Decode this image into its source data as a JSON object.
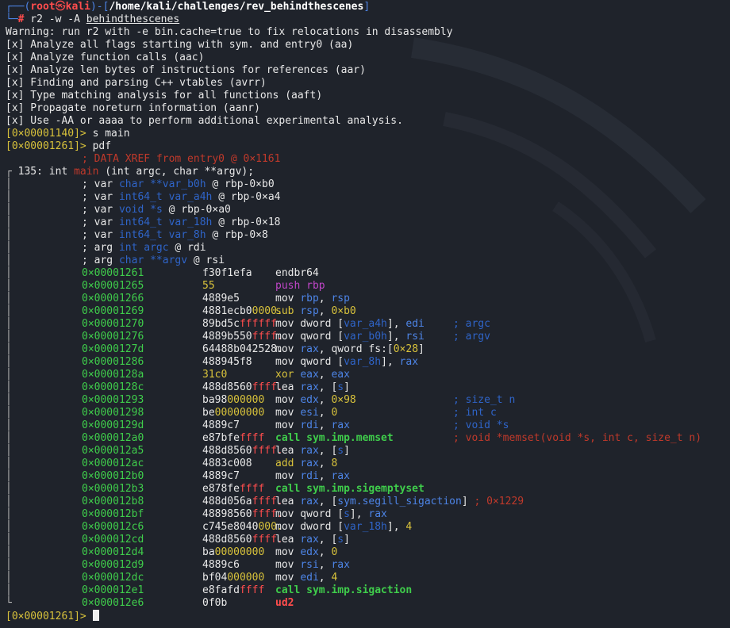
{
  "header": {
    "corner_top": "┌──(",
    "user": "root",
    "at": "㉿",
    "host": "kali",
    "sep": ")-[",
    "path": "/home/kali/challenges/rev_behindthescenes",
    "close": "]",
    "corner_bottom": "└─",
    "hash": "#",
    "cmd": " r2 -w -A ",
    "cmd_arg": "behindthescenes"
  },
  "output": [
    "Warning: run r2 with -e bin.cache=true to fix relocations in disassembly",
    "[x] Analyze all flags starting with sym. and entry0 (aa)",
    "[x] Analyze function calls (aac)",
    "[x] Analyze len bytes of instructions for references (aar)",
    "[x] Finding and parsing C++ vtables (avrr)",
    "[x] Type matching analysis for all functions (aaft)",
    "[x] Propagate noreturn information (aanr)",
    "[x] Use -AA or aaaa to perform additional experimental analysis."
  ],
  "prompts": {
    "p1": "[0×00001140]>",
    "p1_cmd": " s main",
    "p2": "[0×00001261]>",
    "p2_cmd": " pdf",
    "final": "[0×00001261]>"
  },
  "func": {
    "xref": "; DATA XREF from entry0 @ 0×1161",
    "bracket": "┌",
    "size": " 135: int ",
    "name": "main",
    "sig": " (int argc, char **argv);",
    "vars": [
      {
        "kw": "; var ",
        "type": "char **",
        "name": "var_b0h",
        "loc": " @ rbp-0×b0"
      },
      {
        "kw": "; var ",
        "type": "int64_t ",
        "name": "var_a4h",
        "loc": " @ rbp-0×a4"
      },
      {
        "kw": "; var ",
        "type": "void *",
        "name": "s",
        "loc": " @ rbp-0×a0"
      },
      {
        "kw": "; var ",
        "type": "int64_t ",
        "name": "var_18h",
        "loc": " @ rbp-0×18"
      },
      {
        "kw": "; var ",
        "type": "int64_t ",
        "name": "var_8h",
        "loc": " @ rbp-0×8"
      },
      {
        "kw": "; arg ",
        "type": "int ",
        "name": "argc",
        "loc": " @ rdi"
      },
      {
        "kw": "; arg ",
        "type": "char **",
        "name": "argv",
        "loc": " @ rsi"
      }
    ]
  },
  "disasm": [
    {
      "addr": "0×00001261",
      "b1": "f30f1efa",
      "b2": "",
      "ins": [
        [
          "w",
          "endbr64"
        ]
      ],
      "cm": ""
    },
    {
      "addr": "0×00001265",
      "b1": "",
      "b2": "55",
      "b2c": "y",
      "ins": [
        [
          "m",
          "push rbp"
        ]
      ],
      "cm": ""
    },
    {
      "addr": "0×00001266",
      "b1": "4889e5",
      "b2": "",
      "ins": [
        [
          "w",
          "mov "
        ],
        [
          "b",
          "rbp"
        ],
        [
          "w",
          ", "
        ],
        [
          "b",
          "rsp"
        ]
      ],
      "cm": ""
    },
    {
      "addr": "0×00001269",
      "b1": "4881ecb0",
      "b2": "0000.",
      "b2c": "y",
      "ins": [
        [
          "y",
          "sub "
        ],
        [
          "b",
          "rsp"
        ],
        [
          "w",
          ", "
        ],
        [
          "y",
          "0×b0"
        ]
      ],
      "cm": ""
    },
    {
      "addr": "0×00001270",
      "b1": "89bd5c",
      "b2": "ffffff",
      "b2c": "r",
      "ins": [
        [
          "w",
          "mov dword ["
        ],
        [
          "d",
          "var_a4h"
        ],
        [
          "w",
          "], "
        ],
        [
          "b",
          "edi"
        ]
      ],
      "cm": "; argc"
    },
    {
      "addr": "0×00001276",
      "b1": "4889b550",
      "b2": "ffff.",
      "b2c": "r",
      "ins": [
        [
          "w",
          "mov qword ["
        ],
        [
          "d",
          "var_b0h"
        ],
        [
          "w",
          "], "
        ],
        [
          "b",
          "rsi"
        ]
      ],
      "cm": "; argv"
    },
    {
      "addr": "0×0000127d",
      "b1": "64488b042528.",
      "b2": "",
      "ins": [
        [
          "w",
          "mov "
        ],
        [
          "b",
          "rax"
        ],
        [
          "w",
          ", qword fs:["
        ],
        [
          "y",
          "0×28"
        ],
        [
          "w",
          "]"
        ]
      ],
      "cm": ""
    },
    {
      "addr": "0×00001286",
      "b1": "488945f8",
      "b2": "",
      "ins": [
        [
          "w",
          "mov qword ["
        ],
        [
          "d",
          "var_8h"
        ],
        [
          "w",
          "], "
        ],
        [
          "b",
          "rax"
        ]
      ],
      "cm": ""
    },
    {
      "addr": "0×0000128a",
      "b1": "",
      "b2": "31c0",
      "b2c": "y",
      "ins": [
        [
          "y",
          "xor "
        ],
        [
          "b",
          "eax"
        ],
        [
          "w",
          ", "
        ],
        [
          "b",
          "eax"
        ]
      ],
      "cm": ""
    },
    {
      "addr": "0×0000128c",
      "b1": "488d8560",
      "b2": "ffff.",
      "b2c": "r",
      "ins": [
        [
          "w",
          "lea "
        ],
        [
          "b",
          "rax"
        ],
        [
          "w",
          ", ["
        ],
        [
          "d",
          "s"
        ],
        [
          "w",
          "]"
        ]
      ],
      "cm": ""
    },
    {
      "addr": "0×00001293",
      "b1": "ba98",
      "b2": "000000",
      "b2c": "y",
      "ins": [
        [
          "w",
          "mov "
        ],
        [
          "b",
          "edx"
        ],
        [
          "w",
          ", "
        ],
        [
          "y",
          "0×98"
        ]
      ],
      "cm": "; size_t n"
    },
    {
      "addr": "0×00001298",
      "b1": "be",
      "b2": "00000000",
      "b2c": "y",
      "ins": [
        [
          "w",
          "mov "
        ],
        [
          "b",
          "esi"
        ],
        [
          "w",
          ", "
        ],
        [
          "y",
          "0"
        ]
      ],
      "cm": "; int c"
    },
    {
      "addr": "0×0000129d",
      "b1": "4889c7",
      "b2": "",
      "ins": [
        [
          "w",
          "mov "
        ],
        [
          "b",
          "rdi"
        ],
        [
          "w",
          ", "
        ],
        [
          "b",
          "rax"
        ]
      ],
      "cm": "; void *s"
    },
    {
      "addr": "0×000012a0",
      "b1": "e87bfe",
      "b2": "ffff",
      "b2c": "r",
      "ins": [
        [
          "g",
          "call sym.imp.memset"
        ]
      ],
      "cm": "; void *memset(void *s, int c, size_t n)",
      "cmc": "r"
    },
    {
      "addr": "0×000012a5",
      "b1": "488d8560",
      "b2": "ffff.",
      "b2c": "r",
      "ins": [
        [
          "w",
          "lea "
        ],
        [
          "b",
          "rax"
        ],
        [
          "w",
          ", ["
        ],
        [
          "d",
          "s"
        ],
        [
          "w",
          "]"
        ]
      ],
      "cm": ""
    },
    {
      "addr": "0×000012ac",
      "b1": "4883c008",
      "b2": "",
      "ins": [
        [
          "y",
          "add "
        ],
        [
          "b",
          "rax"
        ],
        [
          "w",
          ", "
        ],
        [
          "y",
          "8"
        ]
      ],
      "cm": ""
    },
    {
      "addr": "0×000012b0",
      "b1": "4889c7",
      "b2": "",
      "ins": [
        [
          "w",
          "mov "
        ],
        [
          "b",
          "rdi"
        ],
        [
          "w",
          ", "
        ],
        [
          "b",
          "rax"
        ]
      ],
      "cm": ""
    },
    {
      "addr": "0×000012b3",
      "b1": "e878fe",
      "b2": "ffff",
      "b2c": "r",
      "ins": [
        [
          "g",
          "call sym.imp.sigemptyset"
        ]
      ],
      "cm": ""
    },
    {
      "addr": "0×000012b8",
      "b1": "488d056a",
      "b2": "ffff.",
      "b2c": "r",
      "ins": [
        [
          "w",
          "lea "
        ],
        [
          "b",
          "rax"
        ],
        [
          "w",
          ", ["
        ],
        [
          "b",
          "sym.segill_sigaction"
        ],
        [
          "w",
          "] "
        ],
        [
          "r",
          "; 0×1229"
        ]
      ],
      "cm": ""
    },
    {
      "addr": "0×000012bf",
      "b1": "48898560",
      "b2": "ffff.",
      "b2c": "r",
      "ins": [
        [
          "w",
          "mov qword ["
        ],
        [
          "d",
          "s"
        ],
        [
          "w",
          "], "
        ],
        [
          "b",
          "rax"
        ]
      ],
      "cm": ""
    },
    {
      "addr": "0×000012c6",
      "b1": "c745e8040",
      "b2": "000.",
      "b2c": "y",
      "ins": [
        [
          "w",
          "mov dword ["
        ],
        [
          "d",
          "var_18h"
        ],
        [
          "w",
          "], "
        ],
        [
          "y",
          "4"
        ]
      ],
      "cm": ""
    },
    {
      "addr": "0×000012cd",
      "b1": "488d8560",
      "b2": "ffff.",
      "b2c": "r",
      "ins": [
        [
          "w",
          "lea "
        ],
        [
          "b",
          "rax"
        ],
        [
          "w",
          ", ["
        ],
        [
          "d",
          "s"
        ],
        [
          "w",
          "]"
        ]
      ],
      "cm": ""
    },
    {
      "addr": "0×000012d4",
      "b1": "ba",
      "b2": "00000000",
      "b2c": "y",
      "ins": [
        [
          "w",
          "mov "
        ],
        [
          "b",
          "edx"
        ],
        [
          "w",
          ", "
        ],
        [
          "y",
          "0"
        ]
      ],
      "cm": ""
    },
    {
      "addr": "0×000012d9",
      "b1": "4889c6",
      "b2": "",
      "ins": [
        [
          "w",
          "mov "
        ],
        [
          "b",
          "rsi"
        ],
        [
          "w",
          ", "
        ],
        [
          "b",
          "rax"
        ]
      ],
      "cm": ""
    },
    {
      "addr": "0×000012dc",
      "b1": "bf04",
      "b2": "000000",
      "b2c": "y",
      "ins": [
        [
          "w",
          "mov "
        ],
        [
          "b",
          "edi"
        ],
        [
          "w",
          ", "
        ],
        [
          "y",
          "4"
        ]
      ],
      "cm": ""
    },
    {
      "addr": "0×000012e1",
      "b1": "e8fafd",
      "b2": "ffff",
      "b2c": "r",
      "ins": [
        [
          "g",
          "call sym.imp.sigaction"
        ]
      ],
      "cm": ""
    },
    {
      "addr": "0×000012e6",
      "b1": "0f0b",
      "b2": "",
      "ins": [
        [
          "rr",
          "ud2"
        ]
      ],
      "cm": ""
    }
  ],
  "colors": {
    "background": "#1f232b",
    "address": "#3fcd4b",
    "register": "#4d84e6",
    "variable": "#2f64c8",
    "number": "#d8c23b",
    "root": "#ff4d4d"
  }
}
